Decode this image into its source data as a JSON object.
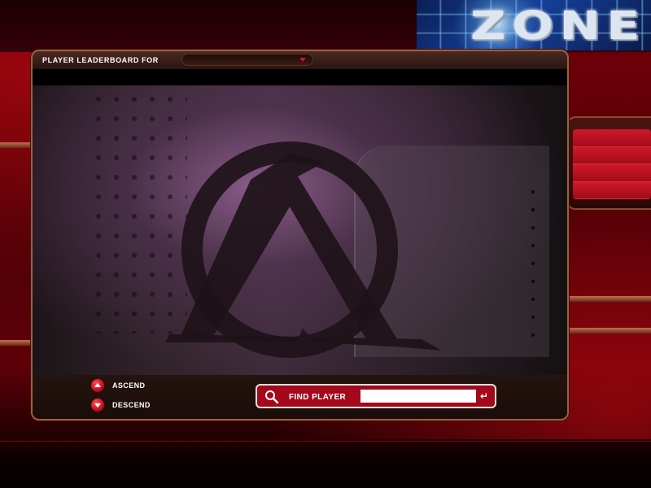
{
  "logo": {
    "text": "ZONE",
    "icon": "zone-logo"
  },
  "leaderboard": {
    "title": "PLAYER LEADERBOARD FOR",
    "dropdown_value": "",
    "emblem_icon": "anarchy-emblem-icon"
  },
  "sort": {
    "ascend_label": "ASCEND",
    "descend_label": "DESCEND"
  },
  "find": {
    "label": "FIND PLAYER",
    "value": "",
    "placeholder": "",
    "search_icon": "search-icon",
    "enter_icon": "enter-icon"
  },
  "colors": {
    "accent_red": "#a3081b",
    "frame_copper": "#a0603a",
    "logo_blue": "#163f9a"
  }
}
